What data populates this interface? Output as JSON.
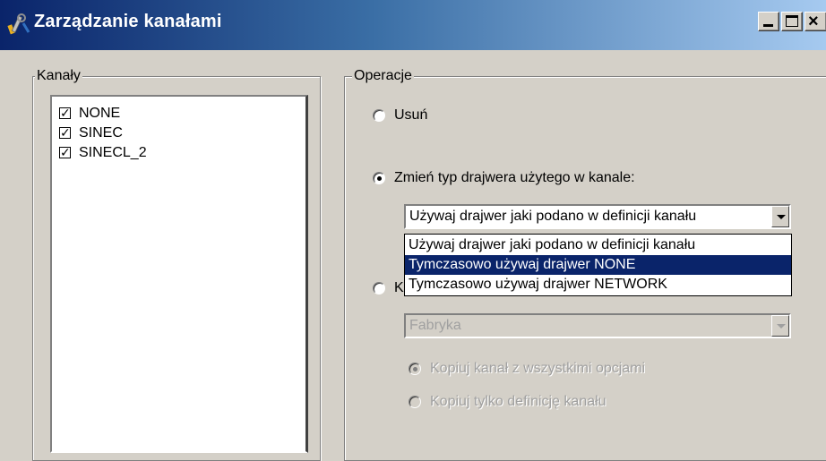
{
  "window": {
    "title": "Zarządzanie kanałami",
    "icon": "app-wrench-icon",
    "controls": {
      "minimize": "minimize-icon",
      "maximize": "maximize-icon",
      "close": "close-icon"
    }
  },
  "channels": {
    "legend": "Kanały",
    "items": [
      {
        "label": "NONE",
        "checked": true
      },
      {
        "label": "SINEC",
        "checked": true
      },
      {
        "label": "SINECL_2",
        "checked": true
      }
    ]
  },
  "operations": {
    "legend": "Operacje",
    "delete_label": "Usuń",
    "change_driver_label": "Zmień typ drajwera użytego w kanale:",
    "driver_combo_value": "Używaj drajwer jaki podano w definicji kanału",
    "driver_options": [
      "Używaj drajwer jaki podano w definicji kanału",
      "Tymczasowo używaj drajwer NONE",
      "Tymczasowo używaj drajwer NETWORK"
    ],
    "selected_option_index": 1,
    "copy_label_visible": "K",
    "factory_combo_value": "Fabryka",
    "copy_all_label": "Kopiuj kanał z wszystkimi opcjami",
    "copy_definition_label": "Kopiuj tylko definicję kanału"
  },
  "colors": {
    "title_gradient_start": "#0a246a",
    "title_gradient_end": "#a6caf0",
    "selection": "#0a246a",
    "face": "#d4d0c8"
  }
}
